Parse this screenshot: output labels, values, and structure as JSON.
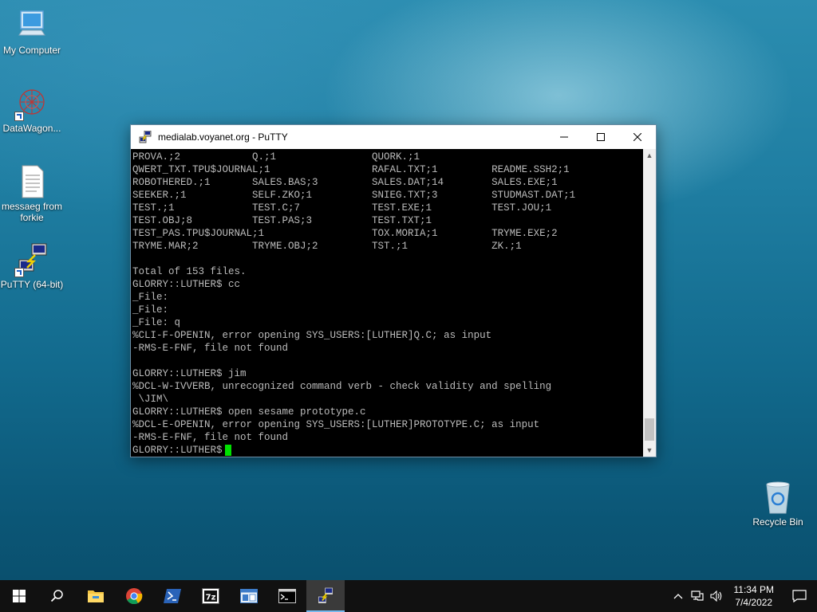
{
  "desktop": {
    "icons": [
      {
        "label": "My Computer"
      },
      {
        "label": "DataWagon..."
      },
      {
        "label": "messaeg from forkie"
      },
      {
        "label": "PuTTY (64-bit)"
      },
      {
        "label": "Recycle Bin"
      }
    ]
  },
  "window": {
    "title": "medialab.voyanet.org - PuTTY",
    "minimize_icon": "minimize-icon",
    "maximize_icon": "maximize-icon",
    "close_icon": "close-icon"
  },
  "terminal": {
    "lines": [
      "PROVA.;2            Q.;1                QUORK.;1",
      "QWERT_TXT.TPU$JOURNAL;1                 RAFAL.TXT;1         README.SSH2;1",
      "ROBOTHERED.;1       SALES.BAS;3         SALES.DAT;14        SALES.EXE;1",
      "SEEKER.;1           SELF.ZKO;1          SNIEG.TXT;3         STUDMAST.DAT;1",
      "TEST.;1             TEST.C;7            TEST.EXE;1          TEST.JOU;1",
      "TEST.OBJ;8          TEST.PAS;3          TEST.TXT;1",
      "TEST_PAS.TPU$JOURNAL;1                  TOX.MORIA;1         TRYME.EXE;2",
      "TRYME.MAR;2         TRYME.OBJ;2         TST.;1              ZK.;1",
      "",
      "Total of 153 files.",
      "GLORRY::LUTHER$ cc",
      "_File:",
      "_File:",
      "_File: q",
      "%CLI-F-OPENIN, error opening SYS_USERS:[LUTHER]Q.C; as input",
      "-RMS-E-FNF, file not found",
      "",
      "GLORRY::LUTHER$ jim",
      "%DCL-W-IVVERB, unrecognized command verb - check validity and spelling",
      " \\JIM\\",
      "GLORRY::LUTHER$ open sesame prototype.c",
      "%DCL-E-OPENIN, error opening SYS_USERS:[LUTHER]PROTOTYPE.C; as input",
      "-RMS-E-FNF, file not found",
      "GLORRY::LUTHER$"
    ],
    "cursor_color": "#00e000"
  },
  "taskbar": {
    "time": "11:34 PM",
    "date": "7/4/2022",
    "items": [
      "start-icon",
      "search-icon",
      "file-explorer-icon",
      "chrome-icon",
      "powershell-icon",
      "7zip-icon",
      "app-window-icon",
      "command-prompt-icon",
      "putty-icon"
    ]
  }
}
